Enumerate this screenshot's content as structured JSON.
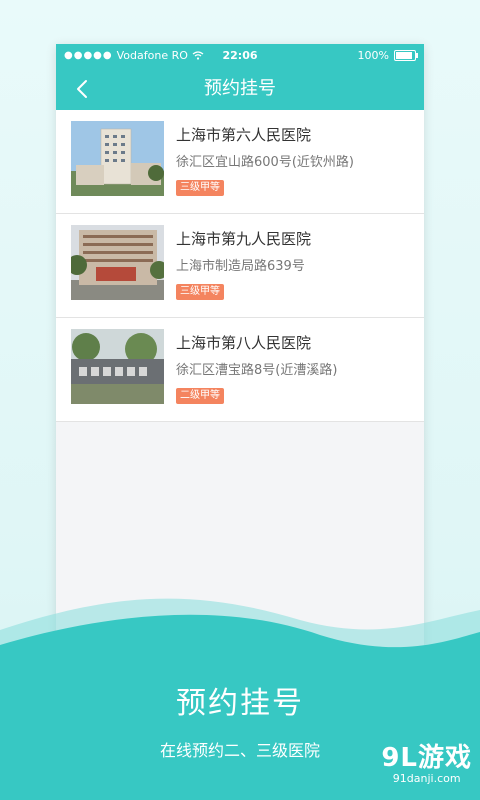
{
  "status_bar": {
    "signal": "●●●●●",
    "carrier": "Vodafone RO",
    "time": "22:06",
    "battery_text": "100%",
    "battery_level": 1.0,
    "icons": [
      "wifi-icon",
      "battery-icon"
    ]
  },
  "nav": {
    "back_icon": "chevron-left-icon",
    "title": "预约挂号"
  },
  "hospitals": [
    {
      "name": "上海市第六人民医院",
      "address": "徐汇区宜山路600号(近钦州路)",
      "grade": "三级甲等"
    },
    {
      "name": "上海市第九人民医院",
      "address": "上海市制造局路639号",
      "grade": "三级甲等"
    },
    {
      "name": "上海市第八人民医院",
      "address": "徐汇区漕宝路8号(近漕溪路)",
      "grade": "二级甲等"
    }
  ],
  "promo": {
    "title": "预约挂号",
    "subtitle": "在线预约二、三级医院"
  },
  "watermark": {
    "main": "9L游戏",
    "sub": "91danji.com"
  },
  "colors": {
    "accent": "#37c8c3",
    "badge": "#f4845f",
    "background": "#dff6f6"
  }
}
